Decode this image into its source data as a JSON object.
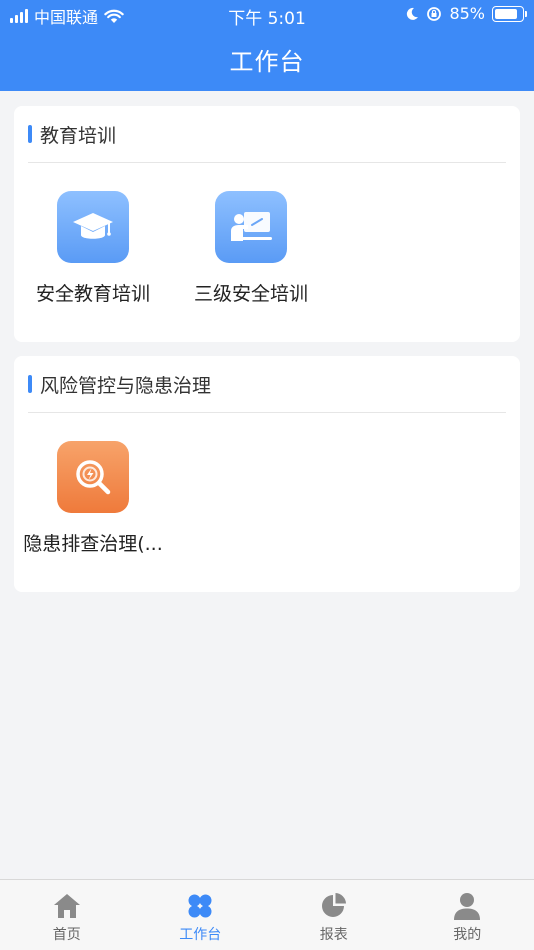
{
  "status_bar": {
    "carrier": "中国联通",
    "time": "下午 5:01",
    "battery": "85%",
    "battery_level": 0.85
  },
  "header": {
    "title": "工作台"
  },
  "sections": [
    {
      "title": "教育培训",
      "items": [
        {
          "label": "安全教育培训",
          "icon": "graduation-cap-icon",
          "color": "#5a9bf5"
        },
        {
          "label": "三级安全培训",
          "icon": "teacher-board-icon",
          "color": "#5a9bf5"
        }
      ]
    },
    {
      "title": "风险管控与隐患治理",
      "items": [
        {
          "label": "隐患排查治理(...",
          "icon": "hazard-search-icon",
          "color": "#ef7a3b"
        }
      ]
    }
  ],
  "tabbar": {
    "tabs": [
      {
        "label": "首页",
        "icon": "home-icon"
      },
      {
        "label": "工作台",
        "icon": "workbench-icon",
        "active": true
      },
      {
        "label": "报表",
        "icon": "pie-chart-icon"
      },
      {
        "label": "我的",
        "icon": "user-icon"
      }
    ]
  },
  "colors": {
    "primary": "#3d8af7",
    "background": "#f3f4f6",
    "accent_orange": "#ef7a3b"
  }
}
